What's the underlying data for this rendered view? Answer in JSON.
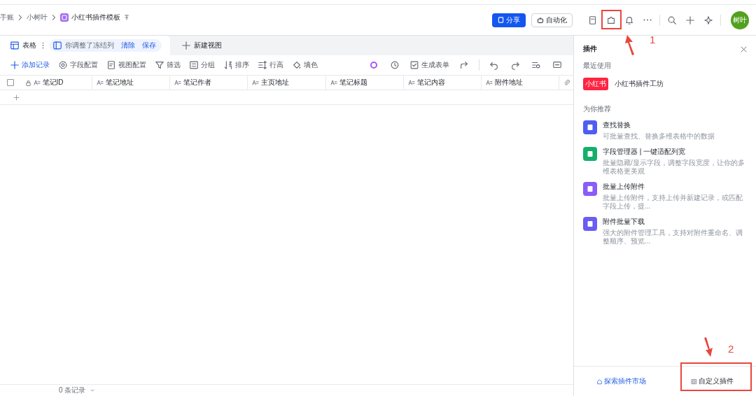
{
  "breadcrumb": [
    {
      "label": "手账"
    },
    {
      "label": "小树叶"
    },
    {
      "label": "小红书插件模板"
    }
  ],
  "top_actions": {
    "share": "分享",
    "automation": "自动化",
    "avatar": "树叶"
  },
  "view_bar": {
    "view_tab": "表格",
    "notice": "你调整了冻结列",
    "clear": "清除",
    "save": "保存",
    "new_view": "新建视图"
  },
  "toolbar": {
    "items": [
      {
        "kind": "add",
        "label": "添加记录"
      },
      {
        "kind": "gear",
        "label": "字段配置"
      },
      {
        "kind": "doc",
        "label": "视图配置"
      },
      {
        "kind": "filter",
        "label": "筛选"
      },
      {
        "kind": "group",
        "label": "分组"
      },
      {
        "kind": "sort",
        "label": "排序"
      },
      {
        "kind": "height",
        "label": "行高"
      },
      {
        "kind": "fill",
        "label": "填色"
      }
    ],
    "generate_form": "生成表单"
  },
  "table": {
    "select_all": {
      "checked": false
    },
    "columns": [
      {
        "label": "笔记ID",
        "locked": true
      },
      {
        "label": "笔记地址",
        "locked": false
      },
      {
        "label": "笔记作者",
        "locked": false
      },
      {
        "label": "主页地址",
        "locked": false
      },
      {
        "label": "笔记标题",
        "locked": false
      },
      {
        "label": "笔记内容",
        "locked": false
      },
      {
        "label": "附件地址",
        "locked": false
      }
    ]
  },
  "footer": {
    "record_count": "0 条记录"
  },
  "plugin_panel": {
    "title": "插件",
    "recent_heading": "最近使用",
    "recent": [
      {
        "name": "小红书插件工坊",
        "badge": "小红书"
      }
    ],
    "recommend_heading": "为你推荐",
    "recommended": [
      {
        "name": "查找替换",
        "desc": "可批量查找、替换多维表格中的数据",
        "color": "#4f5ef0"
      },
      {
        "name": "字段管理器 | 一键适配列宽",
        "desc": "批量隐藏/显示字段，调整字段宽度，让你的多维表格更美观",
        "color": "#14b06b"
      },
      {
        "name": "批量上传附件",
        "desc": "批量上传附件，支持上传并新建记录，或匹配字段上传，提...",
        "color": "#8b5cf6"
      },
      {
        "name": "附件批量下载",
        "desc": "强大的附件管理工具，支持对附件重命名、调整顺序、预览...",
        "color": "#6b5cf2"
      }
    ],
    "explore": "探索插件市场",
    "custom": "自定义插件"
  },
  "annotations": [
    {
      "label": "1"
    },
    {
      "label": "2"
    }
  ]
}
